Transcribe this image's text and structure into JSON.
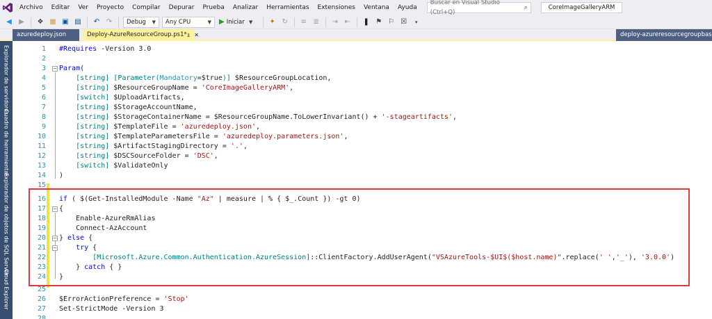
{
  "menubar": {
    "items": [
      "Archivo",
      "Editar",
      "Ver",
      "Proyecto",
      "Compilar",
      "Depurar",
      "Prueba",
      "Analizar",
      "Herramientas",
      "Extensiones",
      "Ventana",
      "Ayuda"
    ],
    "search_placeholder": "Buscar en Visual Studio (Ctrl+Q)",
    "solution_name": "CoreImageGalleryARM"
  },
  "toolbar": {
    "config": "Debug",
    "platform": "Any CPU",
    "run_label": "Iniciar"
  },
  "tabs": {
    "left": "azuredeploy.json",
    "active": "Deploy-AzureResourceGroup.ps1*",
    "right": "deploy-azureresourcegroupbashcli.sh"
  },
  "side_panels": [
    "Explorador de servidores",
    "Cuadro de herramientas",
    "Explorador de objetos de SQL Server",
    "Cloud Explorer"
  ],
  "colors": {
    "accent_tab": "#fff29d",
    "side_strip": "#364e6f",
    "highlight": "#e0393e"
  },
  "code": {
    "lines": [
      {
        "n": "1",
        "text": "#Requires -Version 3.0"
      },
      {
        "n": "2",
        "text": ""
      },
      {
        "n": "3",
        "text": "Param("
      },
      {
        "n": "4",
        "text": "    [string] [Parameter(Mandatory=$true)] $ResourceGroupLocation,"
      },
      {
        "n": "5",
        "text": "    [string] $ResourceGroupName = 'CoreImageGalleryARM',"
      },
      {
        "n": "6",
        "text": "    [switch] $UploadArtifacts,"
      },
      {
        "n": "7",
        "text": "    [string] $StorageAccountName,"
      },
      {
        "n": "8",
        "text": "    [string] $StorageContainerName = $ResourceGroupName.ToLowerInvariant() + '-stageartifacts',"
      },
      {
        "n": "9",
        "text": "    [string] $TemplateFile = 'azuredeploy.json',"
      },
      {
        "n": "10",
        "text": "    [string] $TemplateParametersFile = 'azuredeploy.parameters.json',"
      },
      {
        "n": "11",
        "text": "    [string] $ArtifactStagingDirectory = '.',"
      },
      {
        "n": "12",
        "text": "    [string] $DSCSourceFolder = 'DSC',"
      },
      {
        "n": "13",
        "text": "    [switch] $ValidateOnly"
      },
      {
        "n": "14",
        "text": ")"
      },
      {
        "n": "15",
        "text": ""
      },
      {
        "n": "16",
        "text": "if ( $(Get-InstalledModule -Name \"Az\" | measure | % { $_.Count }) -gt 0)"
      },
      {
        "n": "17",
        "text": "{"
      },
      {
        "n": "18",
        "text": "    Enable-AzureRmAlias"
      },
      {
        "n": "19",
        "text": "    Connect-AzAccount"
      },
      {
        "n": "20",
        "text": "} else {"
      },
      {
        "n": "21",
        "text": "    try {"
      },
      {
        "n": "22",
        "text": "        [Microsoft.Azure.Common.Authentication.AzureSession]::ClientFactory.AddUserAgent(\"VSAzureTools-$UI$($host.name)\".replace(' ','_'), '3.0.0')"
      },
      {
        "n": "23",
        "text": "    } catch { }"
      },
      {
        "n": "24",
        "text": "}"
      },
      {
        "n": "25",
        "text": ""
      },
      {
        "n": "26",
        "text": "$ErrorActionPreference = 'Stop'"
      },
      {
        "n": "27",
        "text": "Set-StrictMode -Version 3"
      },
      {
        "n": "28",
        "text": ""
      }
    ]
  }
}
